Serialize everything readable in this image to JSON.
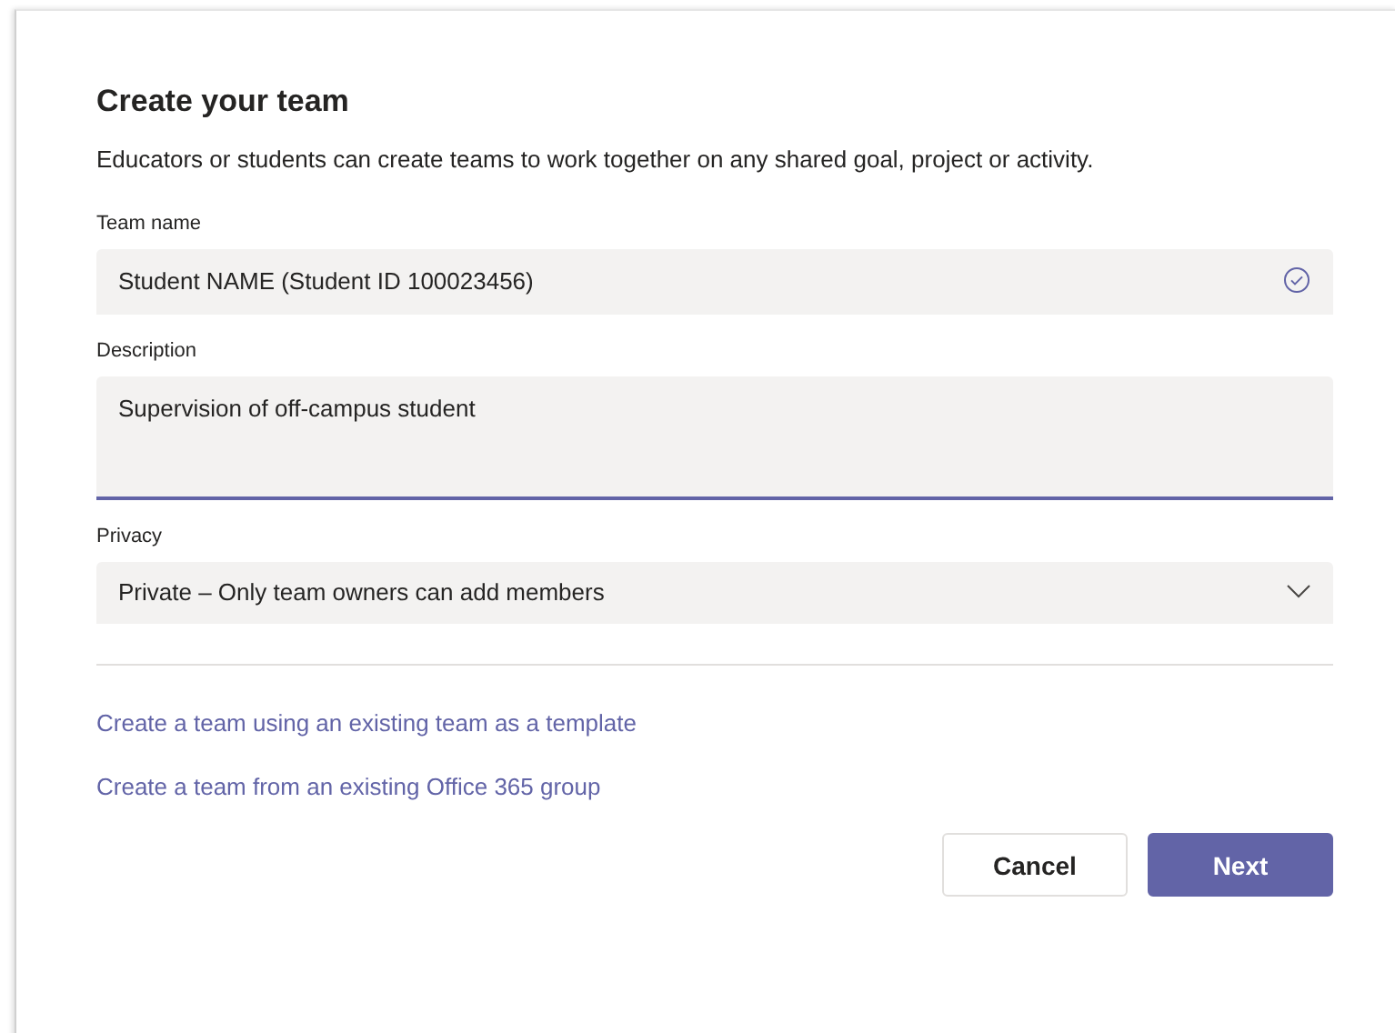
{
  "dialog": {
    "title": "Create your team",
    "subtitle": "Educators or students can create teams to work together on any shared goal, project or activity."
  },
  "fields": [
    {
      "kind": "text",
      "label": "Team name",
      "value": "Student NAME (Student ID 100023456)",
      "valid": true,
      "focused": false
    },
    {
      "kind": "textarea",
      "label": "Description",
      "value": "Supervision of off-campus student",
      "valid": false,
      "focused": true
    },
    {
      "kind": "select",
      "label": "Privacy",
      "value": "Private – Only team owners can add members",
      "valid": false,
      "focused": false
    }
  ],
  "links": [
    "Create a team using an existing team as a template",
    "Create a team from an existing Office 365 group"
  ],
  "buttons": [
    {
      "label": "Cancel",
      "kind": "secondary"
    },
    {
      "label": "Next",
      "kind": "primary"
    }
  ]
}
